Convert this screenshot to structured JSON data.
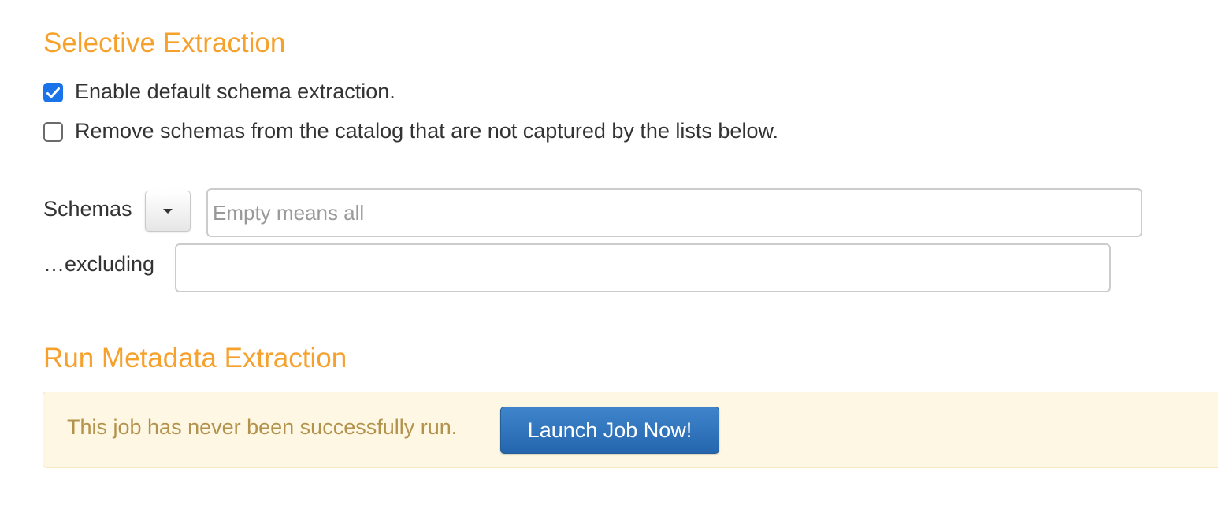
{
  "selective_extraction": {
    "title": "Selective Extraction",
    "enable_default": {
      "label": "Enable default schema extraction.",
      "checked": true
    },
    "remove_schemas": {
      "label": "Remove schemas from the catalog that are not captured by the lists below.",
      "checked": false
    },
    "schemas": {
      "label": "Schemas",
      "placeholder": "Empty means all",
      "value": ""
    },
    "excluding": {
      "label": "…excluding",
      "placeholder": "",
      "value": ""
    }
  },
  "run_metadata_extraction": {
    "title": "Run Metadata Extraction",
    "status_text": "This job has never been successfully run.",
    "launch_button_label": "Launch Job Now!"
  },
  "icons": {
    "checkmark": "checkmark-icon",
    "dropdown": "caret-down-icon"
  },
  "colors": {
    "heading": "#f5a12c",
    "checkbox_checked": "#1a73e8",
    "alert_background": "#fdf7e4",
    "alert_text": "#b3924c",
    "primary_button": "#2566ae"
  }
}
